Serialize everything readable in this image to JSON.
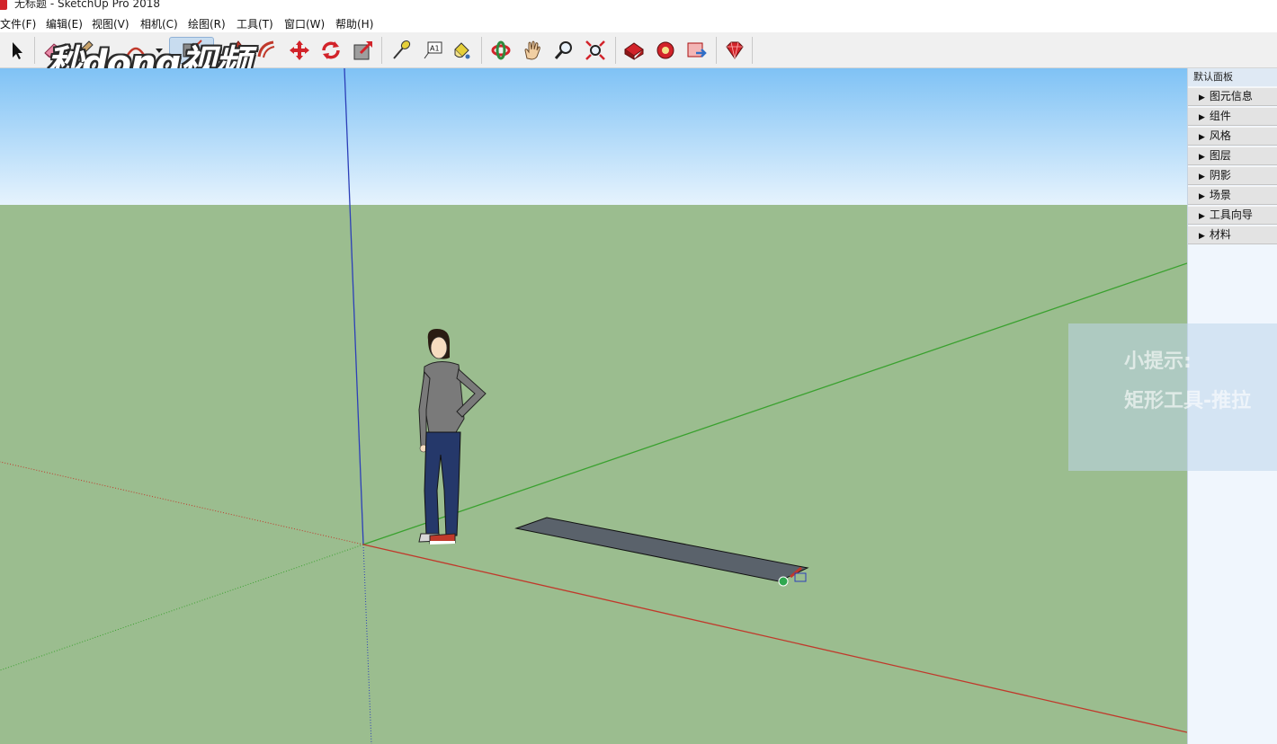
{
  "window": {
    "title": "无标题 - SketchUp Pro 2018"
  },
  "menu": [
    "文件(F)",
    "编辑(E)",
    "视图(V)",
    "相机(C)",
    "绘图(R)",
    "工具(T)",
    "窗口(W)",
    "帮助(H)"
  ],
  "toolbar": {
    "tools": [
      {
        "name": "select",
        "icon": "arrow-cursor-icon"
      },
      {
        "name": "eraser",
        "icon": "eraser-icon"
      },
      {
        "name": "line",
        "icon": "pencil-icon"
      },
      {
        "name": "rectangle",
        "icon": "rectangle-icon",
        "active": true
      },
      {
        "name": "push-pull",
        "icon": "push-pull-icon"
      },
      {
        "name": "offset",
        "icon": "offset-icon"
      },
      {
        "name": "move",
        "icon": "move-icon"
      },
      {
        "name": "rotate",
        "icon": "rotate-icon"
      },
      {
        "name": "scale",
        "icon": "scale-icon"
      },
      {
        "name": "tape-measure",
        "icon": "tape-measure-icon"
      },
      {
        "name": "text",
        "icon": "text-label-icon",
        "label": "A1"
      },
      {
        "name": "paint-bucket",
        "icon": "paint-bucket-icon"
      },
      {
        "name": "orbit",
        "icon": "orbit-icon"
      },
      {
        "name": "pan",
        "icon": "hand-icon"
      },
      {
        "name": "zoom",
        "icon": "magnifier-icon"
      },
      {
        "name": "zoom-extents",
        "icon": "zoom-extents-icon"
      },
      {
        "name": "3d-warehouse",
        "icon": "warehouse-icon"
      },
      {
        "name": "extension-warehouse",
        "icon": "extension-icon"
      },
      {
        "name": "layout",
        "icon": "layout-icon"
      },
      {
        "name": "extension-manager",
        "icon": "ruby-gem-icon"
      }
    ]
  },
  "watermark": {
    "text": "秒dong视频"
  },
  "tray": {
    "title": "默认面板",
    "panels": [
      "图元信息",
      "组件",
      "风格",
      "图层",
      "阴影",
      "场景",
      "工具向导",
      "材料"
    ]
  },
  "tip": {
    "line1": "小提示:",
    "line2": "矩形工具-推拉"
  },
  "colors": {
    "sky_top": "#7fc2f5",
    "sky_bottom": "#e6f3fd",
    "ground": "#9bbd8f",
    "axis_red": "#c0392b",
    "axis_green": "#3aa12f",
    "axis_blue": "#2c3fb8",
    "rectangle_face": "#5a626b",
    "active_tool": "#c8dcef"
  }
}
